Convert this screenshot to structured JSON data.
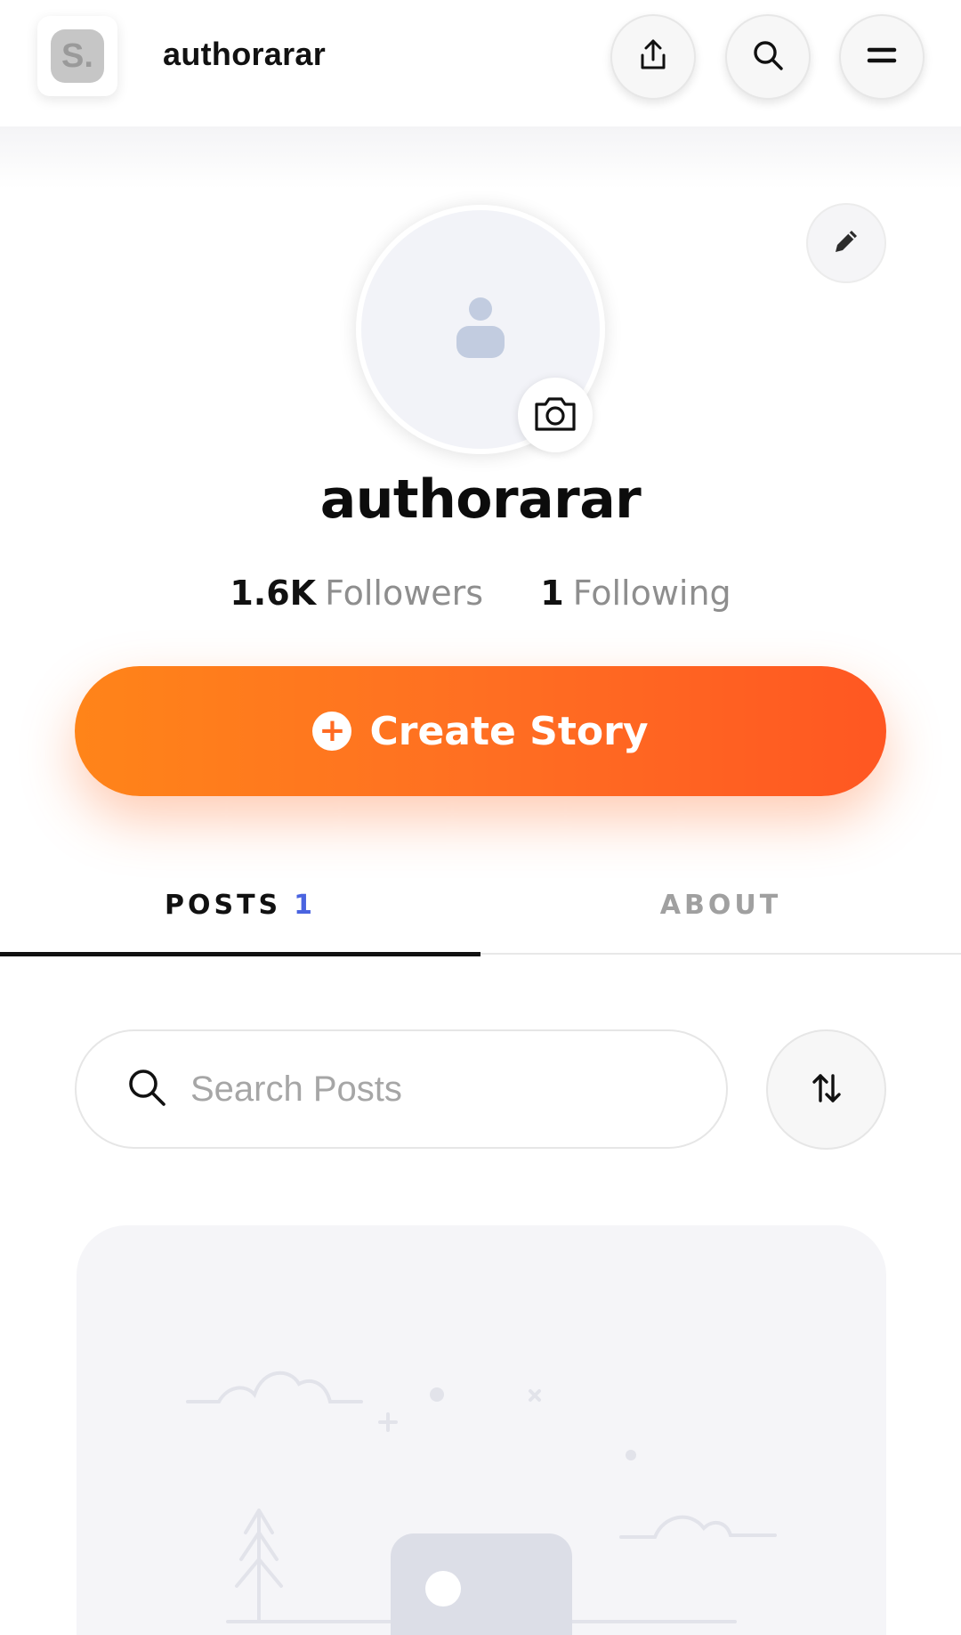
{
  "header": {
    "logo_text": "S.",
    "title": "authorarar",
    "share_icon": "share-icon",
    "search_icon": "search-icon",
    "menu_icon": "menu-icon"
  },
  "profile": {
    "name": "authorarar",
    "followers_count": "1.6K",
    "followers_label": "Followers",
    "following_count": "1",
    "following_label": "Following",
    "avatar_icon": "user-placeholder-icon",
    "camera_icon": "camera-icon",
    "edit_icon": "pencil-icon"
  },
  "create_story": {
    "icon": "plus-icon",
    "label": "Create Story"
  },
  "tabs": [
    {
      "label": "POSTS",
      "count": "1",
      "active": true
    },
    {
      "label": "ABOUT",
      "active": false
    }
  ],
  "search": {
    "placeholder": "Search Posts",
    "icon": "search-icon",
    "sort_icon": "sort-icon"
  },
  "colors": {
    "accent_start": "#ff8419",
    "accent_end": "#ff5722",
    "tab_count": "#4a64e0"
  }
}
